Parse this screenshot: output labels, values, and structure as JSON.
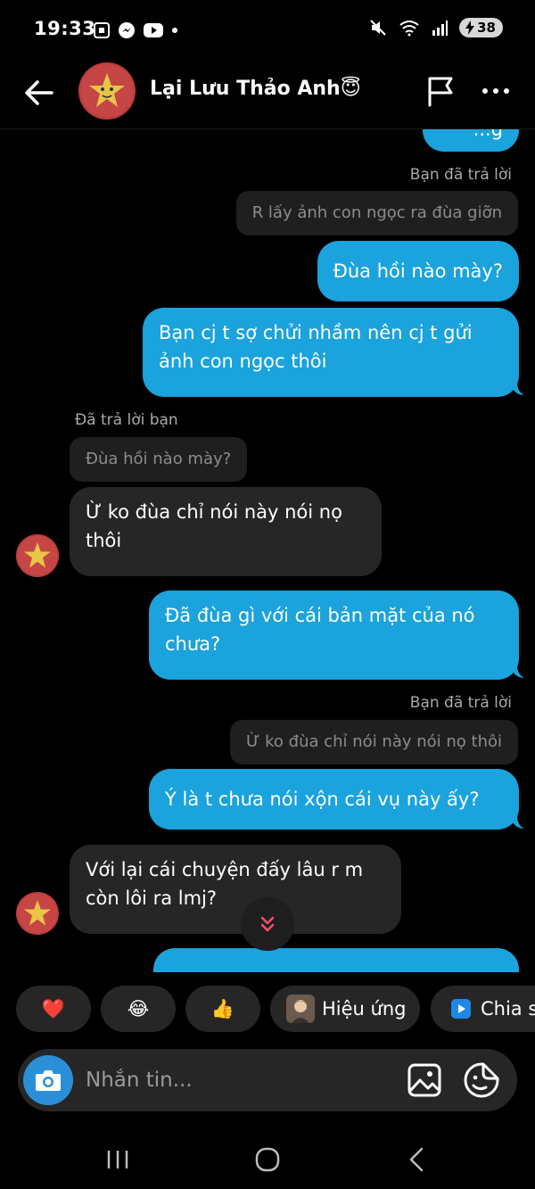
{
  "status": {
    "time": "19:33",
    "battery": "38"
  },
  "header": {
    "contact_name": "Lại Lưu Thảo Anh😇"
  },
  "messages": {
    "top_partial": "...g",
    "reply_label_1": "Bạn đã trả lời",
    "quote_1": "R lấy ảnh con ngọc ra đùa giỡn",
    "out_1": "Đùa hồi nào mày?",
    "out_2_line1": "Bạn cj t sợ chửi nhầm nên cj t gửi",
    "out_2_line2": "ảnh con ngọc thôi",
    "reply_label_2": "Đã trả lời bạn",
    "quote_2": "Đùa hồi nào mày?",
    "in_1_line1": "Ừ ko đùa chỉ nói này nói nọ",
    "in_1_line2": "thôi",
    "out_3_line1": "Đã đùa gì với cái bản mặt của nó",
    "out_3_line2": "chưa?",
    "reply_label_3": "Bạn đã trả lời",
    "quote_3": "Ừ ko đùa chỉ nói này nói nọ thôi",
    "out_4": "Ý là t chưa nói xộn cái vụ này ấy?",
    "in_2_line1": "Với lại cái chuyện đấy lâu r m",
    "in_2_line2": "còn lôi ra lmj?"
  },
  "quick_actions": {
    "heart": "❤️",
    "laugh": "😂",
    "thumbs": "👍",
    "effects": "Hiệu ứng",
    "share": "Chia s"
  },
  "composer": {
    "placeholder": "Nhắn tin..."
  },
  "colors": {
    "outgoing": "#1aa3dc",
    "incoming": "#262626",
    "background": "#000000"
  }
}
